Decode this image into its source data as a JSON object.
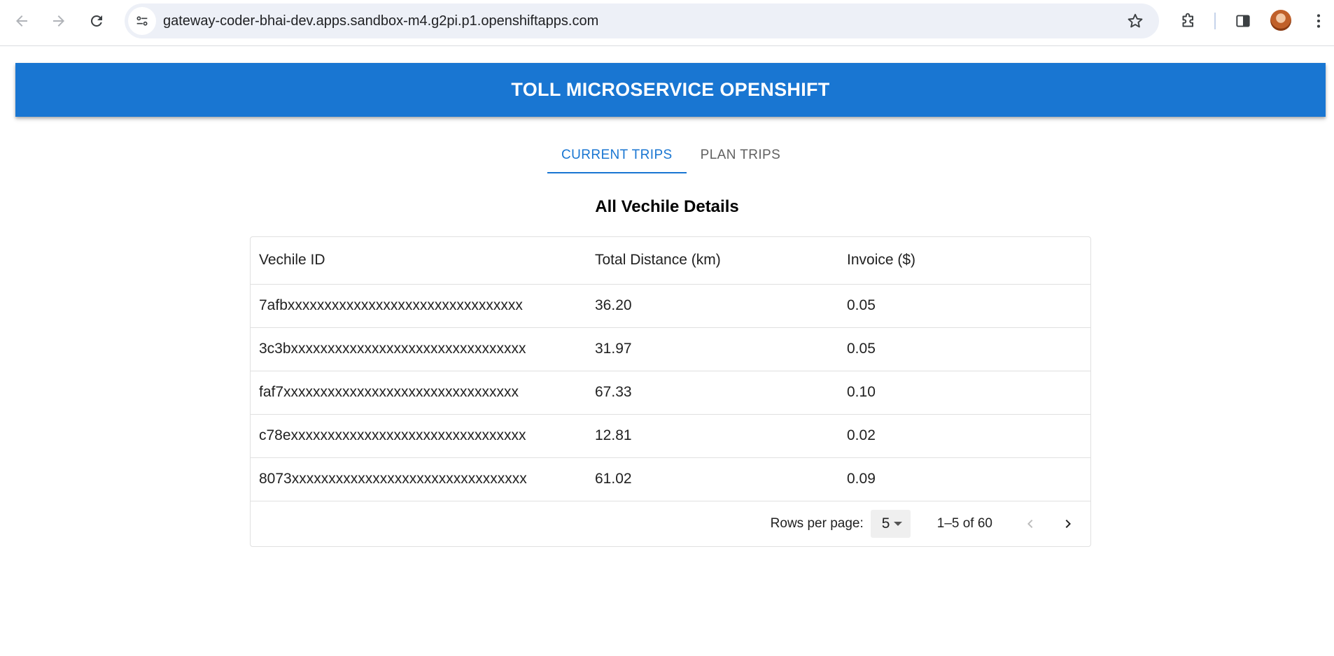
{
  "browser": {
    "url": "gateway-coder-bhai-dev.apps.sandbox-m4.g2pi.p1.openshiftapps.com",
    "icons": [
      "back-arrow-icon",
      "forward-arrow-icon",
      "reload-icon",
      "site-settings-icon",
      "star-icon",
      "extensions-puzzle-icon",
      "side-panel-icon",
      "profile-avatar",
      "kebab-menu-icon"
    ]
  },
  "header": {
    "title": "TOLL MICROSERVICE OPENSHIFT",
    "color": "#1976d2"
  },
  "tabs": [
    {
      "label": "CURRENT TRIPS",
      "active": true
    },
    {
      "label": "PLAN TRIPS",
      "active": false
    }
  ],
  "section": {
    "title": "All Vechile Details"
  },
  "table": {
    "columns": [
      "Vechile ID",
      "Total Distance (km)",
      "Invoice ($)"
    ],
    "rows": [
      [
        "7afbxxxxxxxxxxxxxxxxxxxxxxxxxxxxxxxx",
        "36.20",
        "0.05"
      ],
      [
        "3c3bxxxxxxxxxxxxxxxxxxxxxxxxxxxxxxxx",
        "31.97",
        "0.05"
      ],
      [
        "faf7xxxxxxxxxxxxxxxxxxxxxxxxxxxxxxxx",
        "67.33",
        "0.10"
      ],
      [
        "c78exxxxxxxxxxxxxxxxxxxxxxxxxxxxxxxx",
        "12.81",
        "0.02"
      ],
      [
        "8073xxxxxxxxxxxxxxxxxxxxxxxxxxxxxxxx",
        "61.02",
        "0.09"
      ]
    ]
  },
  "pagination": {
    "rows_per_page_label": "Rows per page:",
    "rows_per_page": "5",
    "range": "1–5 of 60"
  }
}
